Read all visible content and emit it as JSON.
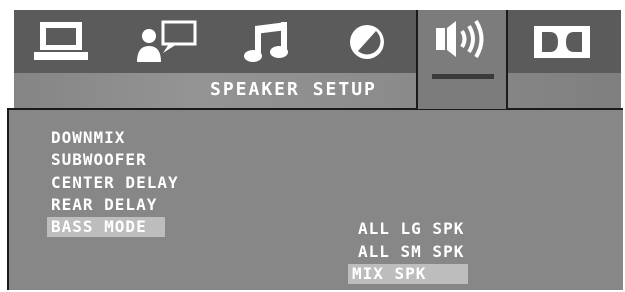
{
  "tabs": [
    {
      "id": "general",
      "icon": "monitor-icon"
    },
    {
      "id": "language",
      "icon": "user-speech-icon"
    },
    {
      "id": "audio",
      "icon": "music-note-icon"
    },
    {
      "id": "video",
      "icon": "contrast-circle-icon"
    },
    {
      "id": "speaker",
      "icon": "speaker-icon",
      "active": true
    },
    {
      "id": "dolby",
      "icon": "dolby-digital-icon"
    }
  ],
  "page_title": "SPEAKER SETUP",
  "menu_items": [
    {
      "label": "DOWNMIX"
    },
    {
      "label": "SUBWOOFER"
    },
    {
      "label": "CENTER DELAY"
    },
    {
      "label": "REAR DELAY"
    },
    {
      "label": "BASS MODE",
      "selected": true
    }
  ],
  "options": [
    {
      "label": "ALL LG SPK"
    },
    {
      "label": "ALL SM SPK"
    },
    {
      "label": "MIX SPK",
      "selected": true
    }
  ],
  "colors": {
    "tab_bar": "#5b5b5b",
    "active_tab": "#7c7c7c",
    "panel": "#878787",
    "highlight": "#bdbdbd",
    "text": "#ffffff"
  }
}
